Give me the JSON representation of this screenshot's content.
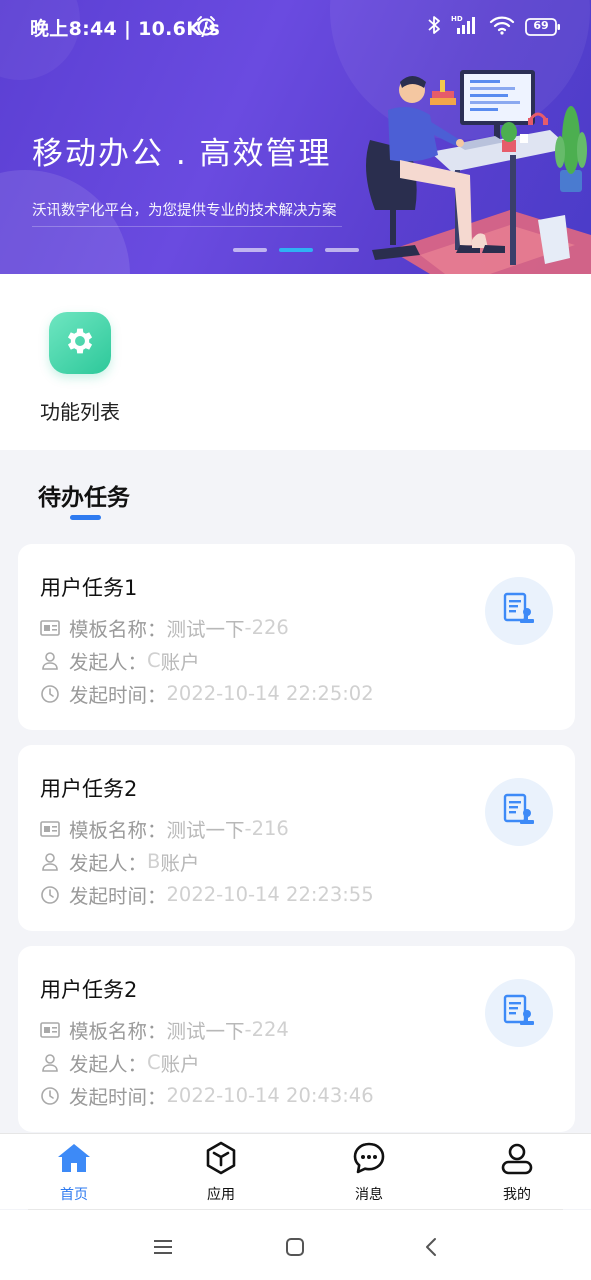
{
  "status_bar": {
    "time_text": "晚上8:44 | 10.6K/s",
    "battery": "69",
    "icons": [
      "alarm-icon",
      "bluetooth-icon",
      "signal-icon",
      "wifi-icon",
      "battery-icon"
    ]
  },
  "banner": {
    "title": "移动办公 . 高效管理",
    "subtitle": "沃讯数字化平台，为您提供专业的技术解决方案",
    "slides": 3,
    "active_slide": 1
  },
  "functions": [
    {
      "label": "功能列表",
      "icon": "gear-icon",
      "color": "#2dc89a"
    }
  ],
  "todo": {
    "title": "待办任务",
    "field_labels": {
      "template": "模板名称：",
      "initiator": "发起人：",
      "time": "发起时间："
    },
    "tasks": [
      {
        "title": "用户任务1",
        "template_main": "测试一下",
        "template_suffix": "-226",
        "initiator_prefix": "C",
        "initiator_main": "账户",
        "time": "2022-10-14 22:25:02"
      },
      {
        "title": "用户任务2",
        "template_main": "测试一下",
        "template_suffix": "-216",
        "initiator_prefix": "B",
        "initiator_main": "账户",
        "time": "2022-10-14 22:23:55"
      },
      {
        "title": "用户任务2",
        "template_main": "测试一下",
        "template_suffix": "-224",
        "initiator_prefix": "C",
        "initiator_main": "账户",
        "time": "2022-10-14 20:43:46"
      }
    ]
  },
  "tabbar": {
    "active_color": "#2f7bf0",
    "items": [
      {
        "label": "首页",
        "icon": "home-icon",
        "active": true
      },
      {
        "label": "应用",
        "icon": "cube-icon",
        "active": false
      },
      {
        "label": "消息",
        "icon": "chat-icon",
        "active": false
      },
      {
        "label": "我的",
        "icon": "user-icon",
        "active": false
      }
    ]
  },
  "navbar": {
    "icons": [
      "menu-icon",
      "home-square-icon",
      "back-icon"
    ]
  }
}
